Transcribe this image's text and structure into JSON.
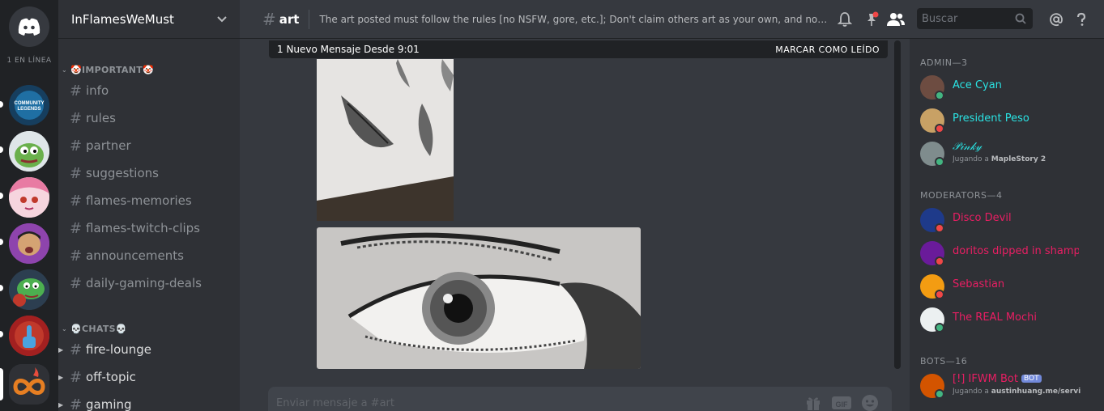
{
  "guilds": {
    "online_label": "1 EN LÍNEA",
    "items": [
      {
        "name": "community-legends",
        "color": "#1f6fa3",
        "label": "COMMUNITY LEGENDS"
      },
      {
        "name": "pepe",
        "color": "#6ab04c"
      },
      {
        "name": "anime",
        "color": "#f0a0b8"
      },
      {
        "name": "person",
        "color": "#8e44ad"
      },
      {
        "name": "pepe-boxing",
        "color": "#4caf50"
      },
      {
        "name": "flame-hand",
        "color": "#c0392b"
      },
      {
        "name": "infinity-flame",
        "color": "#e67e22"
      }
    ]
  },
  "server": {
    "name": "InFlamesWeMust"
  },
  "categories": {
    "important": "🤡IMPORTANT🤡",
    "chats": "💀CHATS💀"
  },
  "channels": {
    "important": [
      "info",
      "rules",
      "partner",
      "suggestions",
      "flames-memories",
      "flames-twitch-clips",
      "announcements",
      "daily-gaming-deals"
    ],
    "chats": [
      "fire-lounge",
      "off-topic",
      "gaming"
    ]
  },
  "topbar": {
    "channel": "art",
    "topic": "The art posted must follow the rules [no NSFW, gore, etc.]; Don't claim others art as your own, and no shitp..."
  },
  "search": {
    "placeholder": "Buscar"
  },
  "new_messages": {
    "text": "1 Nuevo Mensaje Desde 9:01",
    "mark_read": "MARCAR COMO LEÍDO"
  },
  "composer": {
    "placeholder": "Enviar mensaje a #art"
  },
  "members": {
    "admin_header": "ADMIN—3",
    "moderators_header": "MODERATORS—4",
    "bots_header": "BOTS—16",
    "admins": [
      {
        "name": "Ace Cyan",
        "color": "#2ae2e2",
        "status": "#43b581",
        "avatar": "#6d4c41"
      },
      {
        "name": "President Peso",
        "color": "#2ae2e2",
        "status": "#f04747",
        "avatar": "#c8a165"
      },
      {
        "name": "𝒫𝒾𝓃𝓀𝓎",
        "color": "#2ae2e2",
        "status": "#43b581",
        "avatar": "#7f8c8d",
        "activity_prefix": "Jugando a ",
        "activity": "MapleStory 2"
      }
    ],
    "moderators": [
      {
        "name": "Disco Devil",
        "color": "#e91e63",
        "status": "#f04747",
        "avatar": "#1e3a8a"
      },
      {
        "name": "doritos dipped in shampoo",
        "color": "#e91e63",
        "status": "#f04747",
        "avatar": "#6a1b9a"
      },
      {
        "name": "Sebastian",
        "color": "#e91e63",
        "status": "#f04747",
        "avatar": "#f39c12"
      },
      {
        "name": "The REAL Mochi",
        "color": "#e91e63",
        "status": "#43b581",
        "avatar": "#ecf0f1"
      }
    ],
    "bots": [
      {
        "name": "[!] IFWM Bot",
        "tag": "BOT",
        "color": "#e91e63",
        "status": "#43b581",
        "avatar": "#d35400",
        "activity_prefix": "Jugando a ",
        "activity": "austinhuang.me/servi"
      }
    ]
  }
}
